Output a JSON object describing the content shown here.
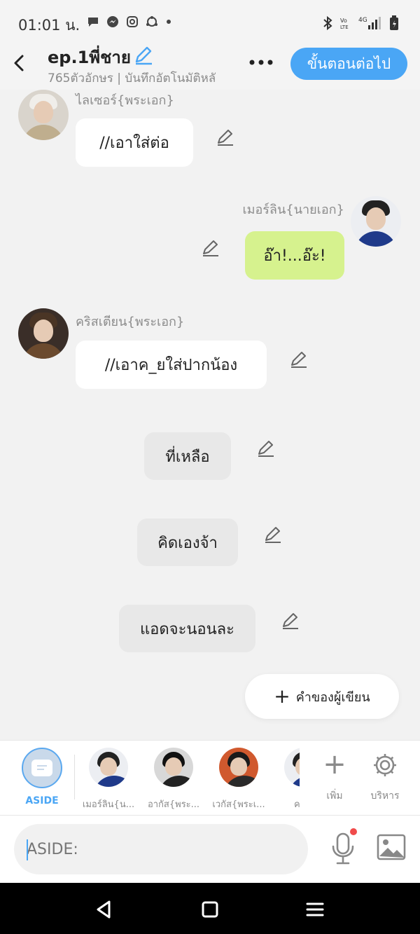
{
  "status": {
    "time": "01:01 น."
  },
  "header": {
    "title": "ep.1พี่ชาย",
    "subtitle": "765ตัวอักษร | บันทึกอัตโนมัติหลั",
    "next_label": "ขั้นตอนต่อไป"
  },
  "messages": [
    {
      "speaker": "ไลเซอร์{พระเอก}",
      "text": "//เอาใส่ต่อ",
      "side": "left"
    },
    {
      "speaker": "เมอร์ลิน{นายเอก}",
      "text": "อ๊า!...อ๊ะ!",
      "side": "right"
    },
    {
      "speaker": "คริสเตียน{พระเอก}",
      "text": "//เอาค_ยใส่ปากน้อง",
      "side": "left"
    },
    {
      "text": "ที่เหลือ",
      "side": "center"
    },
    {
      "text": "คิดเองจ้า",
      "side": "center"
    },
    {
      "text": "แอดจะนอนละ",
      "side": "center"
    }
  ],
  "author_button": "คำของผู้เขียน",
  "charbar": {
    "aside_label": "ASIDE",
    "characters": [
      {
        "name": "เมอร์ลิน{น..."
      },
      {
        "name": "อากัส{พระ..."
      },
      {
        "name": "เวกัส{พระเ..."
      },
      {
        "name": "คริสเ"
      }
    ],
    "add_label": "เพิ่ม",
    "manage_label": "บริหาร"
  },
  "input": {
    "placeholder": "ASIDE:"
  },
  "colors": {
    "accent": "#4aa6f5",
    "green_bubble": "#d6f28e"
  }
}
